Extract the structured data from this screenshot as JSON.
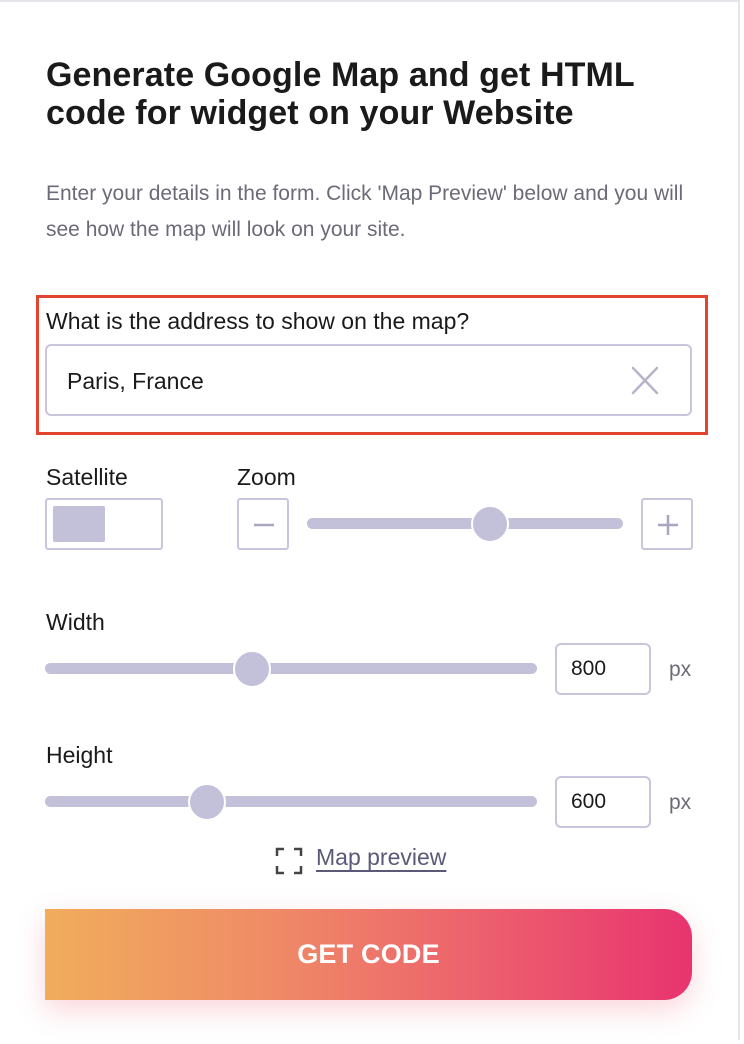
{
  "header": {
    "title": "Generate Google Map and get HTML code for widget on your Website",
    "subtitle": "Enter your details in the form. Click 'Map Preview' below and you will see how the map will look on your site."
  },
  "address": {
    "label": "What is the address to show on the map?",
    "value": "Paris, France",
    "clear_icon": "close-icon"
  },
  "satellite": {
    "label": "Satellite",
    "enabled": false
  },
  "zoom": {
    "label": "Zoom",
    "level_fraction": 0.58,
    "minus_icon": "minus-icon",
    "plus_icon": "plus-icon"
  },
  "width": {
    "label": "Width",
    "value": "800",
    "unit": "px",
    "slider_fraction": 0.42
  },
  "height": {
    "label": "Height",
    "value": "600",
    "unit": "px",
    "slider_fraction": 0.33
  },
  "preview": {
    "label": "Map preview",
    "icon": "fullscreen-icon"
  },
  "cta": {
    "label": "GET CODE"
  },
  "colors": {
    "highlight_border": "#e2452f",
    "control": "#c3c0da",
    "gradient_start": "#f0ad5c",
    "gradient_end": "#e8336f"
  }
}
